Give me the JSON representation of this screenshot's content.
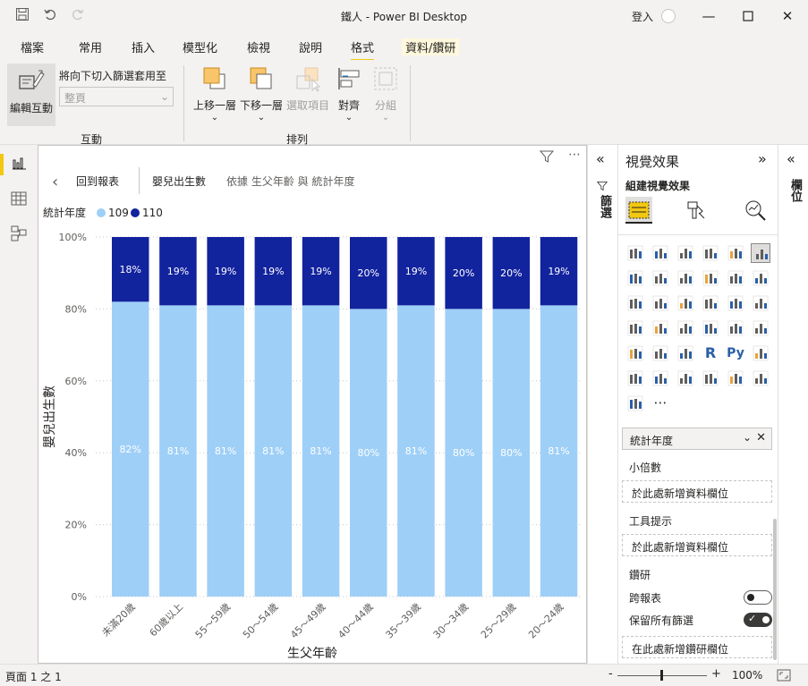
{
  "window": {
    "title": "鐵人 - Power BI Desktop",
    "signin_label": "登入"
  },
  "tabs": [
    {
      "label": "檔案"
    },
    {
      "label": "常用"
    },
    {
      "label": "插入"
    },
    {
      "label": "模型化"
    },
    {
      "label": "檢視"
    },
    {
      "label": "說明"
    },
    {
      "label": "格式"
    },
    {
      "label": "資料/鑽研"
    }
  ],
  "ribbon": {
    "edit_interactions": "編輯互動",
    "drill_filter_label": "將向下切入篩選套用至",
    "drill_filter_value": "整頁",
    "group_interaction": "互動",
    "bring_forward": "上移一層",
    "send_backward": "下移一層",
    "selection": "選取項目",
    "align": "對齊",
    "group": "分組",
    "group_arrange": "排列"
  },
  "canvas": {
    "back_label": "回到報表",
    "visual_title": "嬰兒出生數",
    "visual_subtitle": "依據 生父年齡 與 統計年度",
    "legend_title": "統計年度",
    "more_icon": "⋯"
  },
  "chart_data": {
    "type": "bar",
    "stacking": "percent",
    "xlabel": "生父年齡",
    "ylabel": "嬰兒出生數",
    "ylim": [
      0,
      100
    ],
    "yticks": [
      "0%",
      "20%",
      "40%",
      "60%",
      "80%",
      "100%"
    ],
    "categories": [
      "未滿20歲",
      "60歲以上",
      "55～59歲",
      "50～54歲",
      "45～49歲",
      "40～44歲",
      "35～39歲",
      "30～34歲",
      "25～29歲",
      "20～24歲"
    ],
    "series": [
      {
        "name": "109",
        "color": "#9ecff7",
        "values": [
          82,
          81,
          81,
          81,
          81,
          80,
          81,
          80,
          80,
          81
        ],
        "labels": [
          "82%",
          "81%",
          "81%",
          "81%",
          "81%",
          "80%",
          "81%",
          "80%",
          "80%",
          "81%"
        ]
      },
      {
        "name": "110",
        "color": "#12239e",
        "values": [
          18,
          19,
          19,
          19,
          19,
          20,
          19,
          20,
          20,
          19
        ],
        "labels": [
          "18%",
          "19%",
          "19%",
          "19%",
          "19%",
          "20%",
          "19%",
          "20%",
          "20%",
          "19%"
        ]
      }
    ],
    "grid": true,
    "legend_position": "top-left"
  },
  "filters_pane": {
    "label": "篩選"
  },
  "viz_pane": {
    "title": "視覺效果",
    "subtitle": "組建視覺效果",
    "field_chip": "統計年度",
    "small_multiples_label": "小倍數",
    "add_field": "於此處新增資料欄位",
    "tooltips_label": "工具提示",
    "add_field_2": "於此處新增資料欄位",
    "drill_label": "鑽研",
    "cross_report": "跨報表",
    "keep_filters": "保留所有篩選",
    "add_drill_field": "在此處新增鑽研欄位",
    "more": "⋯"
  },
  "fields_pane": {
    "label": "欄位"
  },
  "status": {
    "page": "頁面 1 之 1",
    "zoom": "100%",
    "minus": "-",
    "plus": "+"
  }
}
